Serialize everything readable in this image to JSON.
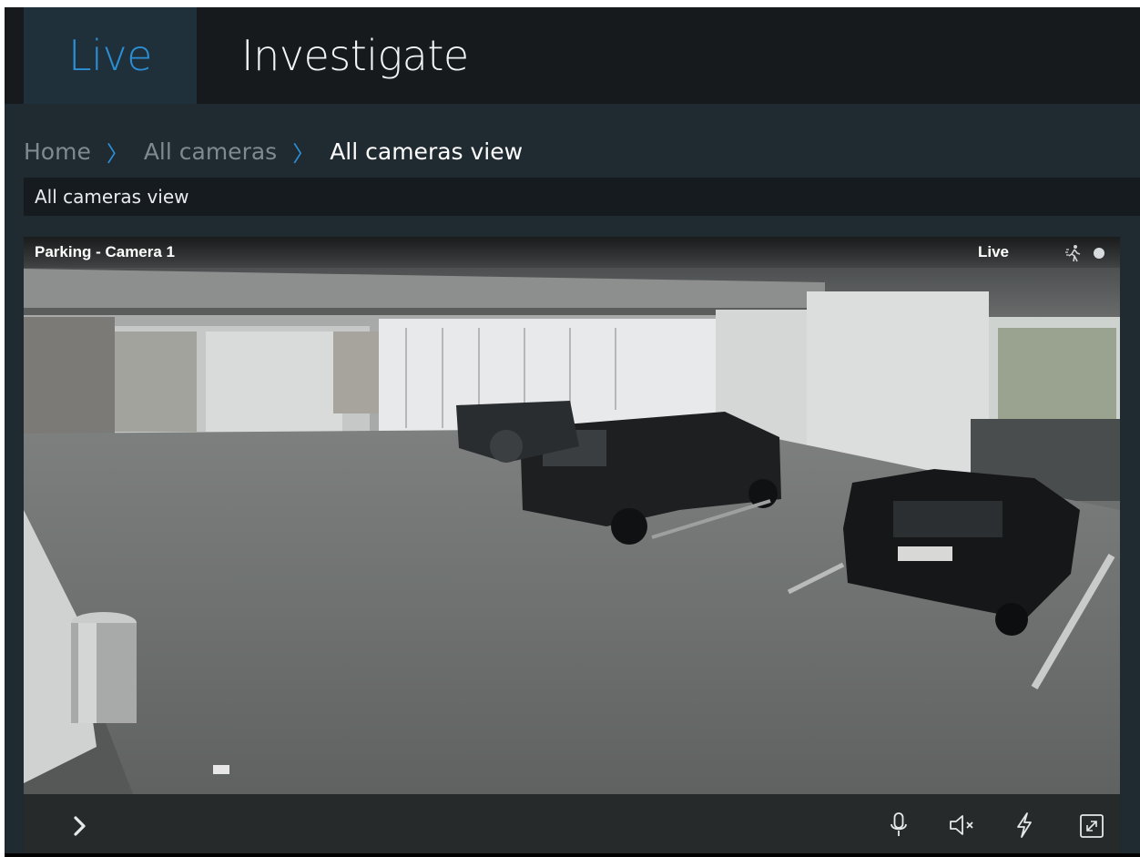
{
  "tabs": {
    "live": "Live",
    "investigate": "Investigate"
  },
  "breadcrumb": {
    "home": "Home",
    "all_cameras": "All cameras",
    "current": "All cameras view",
    "separator": "〉"
  },
  "view": {
    "title": "All cameras view"
  },
  "camera": {
    "name": "Parking - Camera 1",
    "status": "Live"
  },
  "icons": {
    "motion": "motion-detection-icon",
    "recording": "recording-indicator-icon",
    "expand": "chevron-right-icon",
    "microphone": "microphone-icon",
    "speaker": "speaker-muted-icon",
    "output": "lightning-icon",
    "fullscreen": "fullscreen-icon"
  },
  "colors": {
    "accent": "#2b8fd6",
    "topbar": "#161a1d",
    "background": "#1f2a31"
  }
}
